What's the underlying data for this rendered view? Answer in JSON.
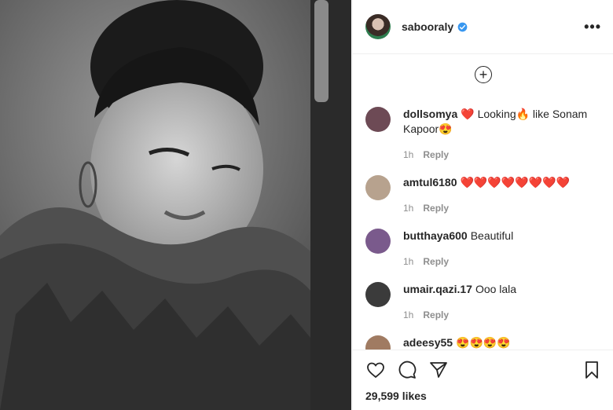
{
  "post": {
    "username": "sabooraly",
    "verified": true,
    "more_label": "•••",
    "add_comment_label": "+"
  },
  "comments": [
    {
      "user": "dollsomya",
      "text": "❤️ Looking🔥 like Sonam Kapoor😍",
      "time": "1h",
      "reply": "Reply",
      "avatar_color": "#6d4a55"
    },
    {
      "user": "amtul6180",
      "text": "❤️❤️❤️❤️❤️❤️❤️❤️",
      "time": "1h",
      "reply": "Reply",
      "avatar_color": "#b7a28e"
    },
    {
      "user": "butthaya600",
      "text": "Beautiful",
      "time": "1h",
      "reply": "Reply",
      "avatar_color": "#7a5a8c"
    },
    {
      "user": "umair.qazi.17",
      "text": "Ooo lala",
      "time": "1h",
      "reply": "Reply",
      "avatar_color": "#3b3b3b"
    },
    {
      "user": "adeesy55",
      "text": "😍😍😍😍",
      "time": "",
      "reply": "",
      "avatar_color": "#a07b62"
    }
  ],
  "likes_text": "29,599 likes",
  "icons": {
    "like": "heart-icon",
    "comment": "comment-icon",
    "share": "share-icon",
    "save": "bookmark-icon",
    "verified": "verified-badge-icon"
  },
  "colors": {
    "verified": "#3897f0",
    "border": "#efefef",
    "meta": "#8e8e8e"
  }
}
